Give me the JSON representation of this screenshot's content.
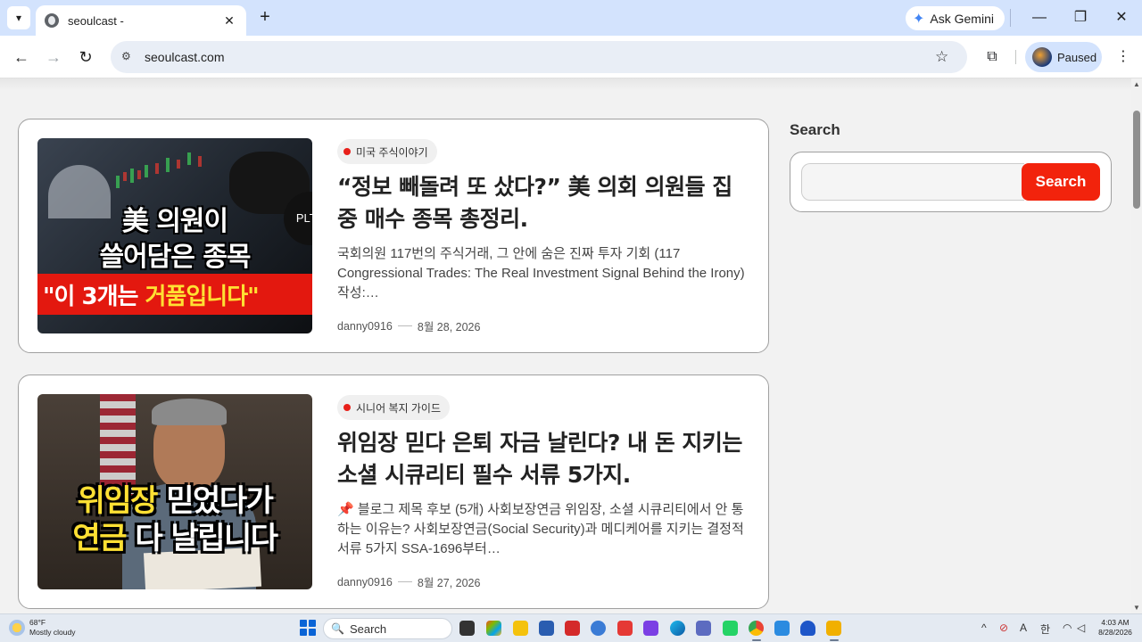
{
  "browser": {
    "tab_title": "seoulcast -",
    "url": "seoulcast.com",
    "gemini_label": "Ask Gemini",
    "profile_label": "Paused"
  },
  "posts": [
    {
      "category": "미국 주식이야기",
      "title": "“정보 빼돌려 또 샀다?” 美 의회 의원들 집중 매수 종목 총정리.",
      "excerpt": "국회의원 117번의 주식거래, 그 안에 숨은 진짜 투자 기회 (117 Congressional Trades: The Real Investment Signal Behind the Irony) 작성:…",
      "author": "danny0916",
      "date": "8월 28, 2026",
      "thumb_line1": "美 의원이",
      "thumb_line2": "쓸어담은 종목",
      "thumb_line3_white": "\"이 3개는 ",
      "thumb_line3_yellow": "거품입니다\"",
      "thumb_badge": "PLTR"
    },
    {
      "category": "시니어 복지 가이드",
      "title": "위임장 믿다 은퇴 자금 날린다? 내 돈 지키는 소셜 시큐리티 필수 서류 5가지.",
      "excerpt": "📌 블로그 제목 후보 (5개) 사회보장연금 위임장, 소셜 시큐리티에서 안 통하는 이유는? 사회보장연금(Social Security)과 메디케어를 지키는 결정적 서류 5가지 SSA-1696부터…",
      "author": "danny0916",
      "date": "8월 27, 2026",
      "thumb_line1_yellow": "위임장",
      "thumb_line1_white": " 믿었다가",
      "thumb_line2_yellow": "연금",
      "thumb_line2_white": " 다 날립니다"
    }
  ],
  "sidebar": {
    "search_title": "Search",
    "search_button": "Search",
    "search_value": ""
  },
  "taskbar": {
    "weather_temp": "68°F",
    "weather_desc": "Mostly cloudy",
    "search_label": "Search",
    "ime_a": "A",
    "ime_han": "한",
    "time": "4:03 AM",
    "date": "8/28/2026"
  }
}
